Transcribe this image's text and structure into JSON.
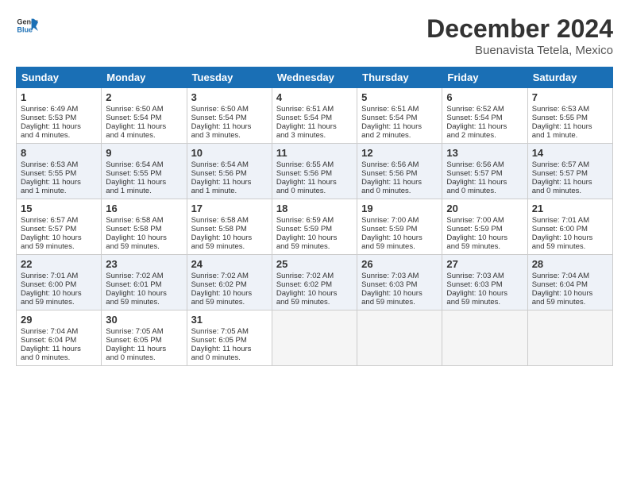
{
  "logo": {
    "text_general": "General",
    "text_blue": "Blue"
  },
  "title": "December 2024",
  "subtitle": "Buenavista Tetela, Mexico",
  "days_of_week": [
    "Sunday",
    "Monday",
    "Tuesday",
    "Wednesday",
    "Thursday",
    "Friday",
    "Saturday"
  ],
  "weeks": [
    [
      {
        "day": "1",
        "lines": [
          "Sunrise: 6:49 AM",
          "Sunset: 5:53 PM",
          "Daylight: 11 hours",
          "and 4 minutes."
        ]
      },
      {
        "day": "2",
        "lines": [
          "Sunrise: 6:50 AM",
          "Sunset: 5:54 PM",
          "Daylight: 11 hours",
          "and 4 minutes."
        ]
      },
      {
        "day": "3",
        "lines": [
          "Sunrise: 6:50 AM",
          "Sunset: 5:54 PM",
          "Daylight: 11 hours",
          "and 3 minutes."
        ]
      },
      {
        "day": "4",
        "lines": [
          "Sunrise: 6:51 AM",
          "Sunset: 5:54 PM",
          "Daylight: 11 hours",
          "and 3 minutes."
        ]
      },
      {
        "day": "5",
        "lines": [
          "Sunrise: 6:51 AM",
          "Sunset: 5:54 PM",
          "Daylight: 11 hours",
          "and 2 minutes."
        ]
      },
      {
        "day": "6",
        "lines": [
          "Sunrise: 6:52 AM",
          "Sunset: 5:54 PM",
          "Daylight: 11 hours",
          "and 2 minutes."
        ]
      },
      {
        "day": "7",
        "lines": [
          "Sunrise: 6:53 AM",
          "Sunset: 5:55 PM",
          "Daylight: 11 hours",
          "and 1 minute."
        ]
      }
    ],
    [
      {
        "day": "8",
        "lines": [
          "Sunrise: 6:53 AM",
          "Sunset: 5:55 PM",
          "Daylight: 11 hours",
          "and 1 minute."
        ]
      },
      {
        "day": "9",
        "lines": [
          "Sunrise: 6:54 AM",
          "Sunset: 5:55 PM",
          "Daylight: 11 hours",
          "and 1 minute."
        ]
      },
      {
        "day": "10",
        "lines": [
          "Sunrise: 6:54 AM",
          "Sunset: 5:56 PM",
          "Daylight: 11 hours",
          "and 1 minute."
        ]
      },
      {
        "day": "11",
        "lines": [
          "Sunrise: 6:55 AM",
          "Sunset: 5:56 PM",
          "Daylight: 11 hours",
          "and 0 minutes."
        ]
      },
      {
        "day": "12",
        "lines": [
          "Sunrise: 6:56 AM",
          "Sunset: 5:56 PM",
          "Daylight: 11 hours",
          "and 0 minutes."
        ]
      },
      {
        "day": "13",
        "lines": [
          "Sunrise: 6:56 AM",
          "Sunset: 5:57 PM",
          "Daylight: 11 hours",
          "and 0 minutes."
        ]
      },
      {
        "day": "14",
        "lines": [
          "Sunrise: 6:57 AM",
          "Sunset: 5:57 PM",
          "Daylight: 11 hours",
          "and 0 minutes."
        ]
      }
    ],
    [
      {
        "day": "15",
        "lines": [
          "Sunrise: 6:57 AM",
          "Sunset: 5:57 PM",
          "Daylight: 10 hours",
          "and 59 minutes."
        ]
      },
      {
        "day": "16",
        "lines": [
          "Sunrise: 6:58 AM",
          "Sunset: 5:58 PM",
          "Daylight: 10 hours",
          "and 59 minutes."
        ]
      },
      {
        "day": "17",
        "lines": [
          "Sunrise: 6:58 AM",
          "Sunset: 5:58 PM",
          "Daylight: 10 hours",
          "and 59 minutes."
        ]
      },
      {
        "day": "18",
        "lines": [
          "Sunrise: 6:59 AM",
          "Sunset: 5:59 PM",
          "Daylight: 10 hours",
          "and 59 minutes."
        ]
      },
      {
        "day": "19",
        "lines": [
          "Sunrise: 7:00 AM",
          "Sunset: 5:59 PM",
          "Daylight: 10 hours",
          "and 59 minutes."
        ]
      },
      {
        "day": "20",
        "lines": [
          "Sunrise: 7:00 AM",
          "Sunset: 5:59 PM",
          "Daylight: 10 hours",
          "and 59 minutes."
        ]
      },
      {
        "day": "21",
        "lines": [
          "Sunrise: 7:01 AM",
          "Sunset: 6:00 PM",
          "Daylight: 10 hours",
          "and 59 minutes."
        ]
      }
    ],
    [
      {
        "day": "22",
        "lines": [
          "Sunrise: 7:01 AM",
          "Sunset: 6:00 PM",
          "Daylight: 10 hours",
          "and 59 minutes."
        ]
      },
      {
        "day": "23",
        "lines": [
          "Sunrise: 7:02 AM",
          "Sunset: 6:01 PM",
          "Daylight: 10 hours",
          "and 59 minutes."
        ]
      },
      {
        "day": "24",
        "lines": [
          "Sunrise: 7:02 AM",
          "Sunset: 6:02 PM",
          "Daylight: 10 hours",
          "and 59 minutes."
        ]
      },
      {
        "day": "25",
        "lines": [
          "Sunrise: 7:02 AM",
          "Sunset: 6:02 PM",
          "Daylight: 10 hours",
          "and 59 minutes."
        ]
      },
      {
        "day": "26",
        "lines": [
          "Sunrise: 7:03 AM",
          "Sunset: 6:03 PM",
          "Daylight: 10 hours",
          "and 59 minutes."
        ]
      },
      {
        "day": "27",
        "lines": [
          "Sunrise: 7:03 AM",
          "Sunset: 6:03 PM",
          "Daylight: 10 hours",
          "and 59 minutes."
        ]
      },
      {
        "day": "28",
        "lines": [
          "Sunrise: 7:04 AM",
          "Sunset: 6:04 PM",
          "Daylight: 10 hours",
          "and 59 minutes."
        ]
      }
    ],
    [
      {
        "day": "29",
        "lines": [
          "Sunrise: 7:04 AM",
          "Sunset: 6:04 PM",
          "Daylight: 11 hours",
          "and 0 minutes."
        ]
      },
      {
        "day": "30",
        "lines": [
          "Sunrise: 7:05 AM",
          "Sunset: 6:05 PM",
          "Daylight: 11 hours",
          "and 0 minutes."
        ]
      },
      {
        "day": "31",
        "lines": [
          "Sunrise: 7:05 AM",
          "Sunset: 6:05 PM",
          "Daylight: 11 hours",
          "and 0 minutes."
        ]
      },
      {
        "day": "",
        "lines": []
      },
      {
        "day": "",
        "lines": []
      },
      {
        "day": "",
        "lines": []
      },
      {
        "day": "",
        "lines": []
      }
    ]
  ]
}
